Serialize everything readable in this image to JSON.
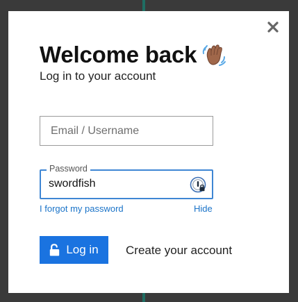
{
  "modal": {
    "title": "Welcome back",
    "subtitle": "Log in to your account",
    "close_icon": "close-icon",
    "wave_icon": "waving-hand-icon"
  },
  "form": {
    "email_placeholder": "Email / Username",
    "email_value": "",
    "password_label": "Password",
    "password_value": "swordfish",
    "password_manager_icon": "password-manager-icon",
    "forgot_link": "I forgot my password",
    "hide_link": "Hide",
    "login_label": "Log in",
    "login_icon": "unlock-icon",
    "create_account": "Create your account"
  },
  "colors": {
    "accent": "#1a73e0",
    "link": "#1a73c8",
    "focus_border": "#3e86d4"
  }
}
